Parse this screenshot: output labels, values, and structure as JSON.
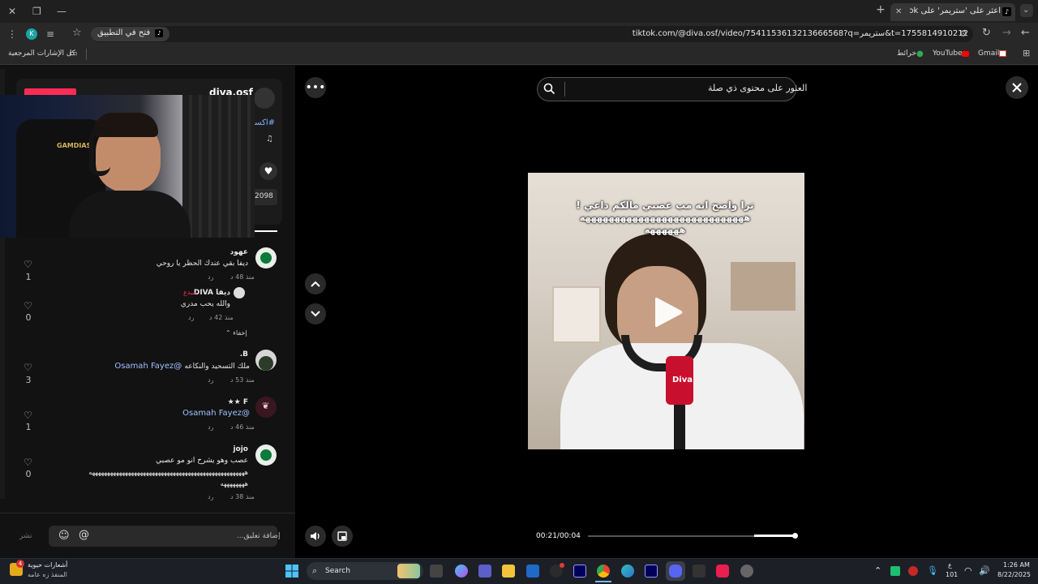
{
  "browser": {
    "tab_title": "اعثر على 'ستريمر' على TikTok | TikTok",
    "url": "tiktok.com/@diva.osf/video/7541153613213666568?q=ستريمر&t=1755814910212",
    "open_in_app": "فتح في التطبيق",
    "profile_initial": "K",
    "bookmarks": {
      "all": "كل الإشارات المرجعية",
      "gmail": "Gmail",
      "youtube": "YouTube",
      "maps": "خرائط"
    }
  },
  "tiktok": {
    "search_placeholder": "العثور على محتوى ذي صلة",
    "video": {
      "caption_line1": "ترا واضح انه مب عصبي مالكم داعي !",
      "caption_line2": "ههههههههههههههههههههههههههههه",
      "caption_line3": "ههههههه",
      "mic_brand": "Diva",
      "current_time": "00:21/00:04",
      "progress": 0.8
    },
    "post": {
      "author": "diva.osf",
      "hashtag": "#اكسبلور",
      "count": "2098"
    },
    "comments": [
      {
        "name": "عهود",
        "text": "ديفا بقي عندك الحظر يا روحي",
        "time": "منذ 48 د",
        "reply": "رد",
        "likes": "1"
      },
      {
        "name": "ديفا DIVA",
        "creator_tag": "· مبدع",
        "text": "والله يحب مدري",
        "time": "منذ 42 د",
        "reply": "رد",
        "likes": "0"
      },
      {
        "name": "B.",
        "text": "ملك التسحيد والنكاعه",
        "mention": "@Osamah Fayez",
        "time": "منذ 53 د",
        "reply": "رد",
        "likes": "3"
      },
      {
        "name": "F ★★",
        "mention": "@Osamah Fayez",
        "time": "منذ 46 د",
        "reply": "رد",
        "likes": "1"
      },
      {
        "name": "jojo",
        "text": "عصب وهو يشرح انو مو عصبي",
        "text2": "ههههههههههههههههههههههههههههههههههههههههههههههههههههه",
        "text3": "ههههههههه",
        "time": "منذ 38 د",
        "reply": "رد",
        "likes": "0"
      }
    ],
    "hide_replies": "إخفاء",
    "comment_placeholder": "إضافة تعليق...",
    "post_button": "نشر"
  },
  "taskbar": {
    "search": "Search",
    "notif_title": "أشعارات حيوية",
    "notif_sub": "المنفذ زه عامه",
    "notif_badge": "4",
    "lang": "ع",
    "lang_sub": "101",
    "time": "1:26 AM",
    "date": "8/22/2025"
  }
}
